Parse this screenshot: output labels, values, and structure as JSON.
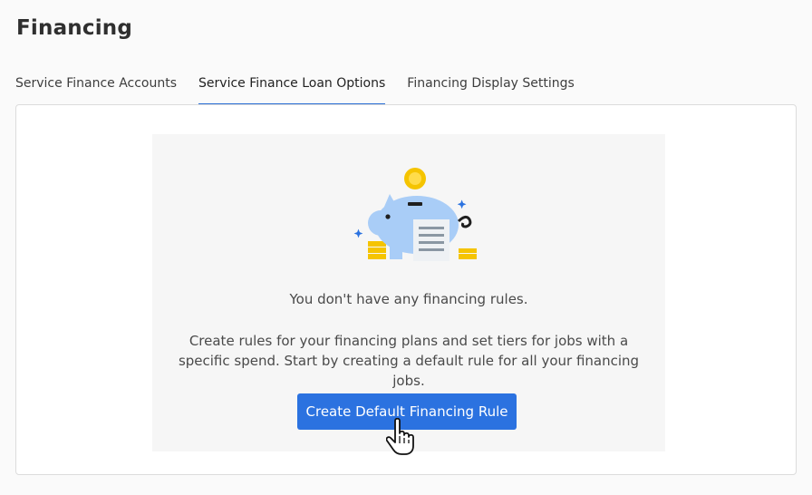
{
  "page": {
    "title": "Financing"
  },
  "tabs": [
    {
      "label": "Service Finance Accounts",
      "active": false
    },
    {
      "label": "Service Finance Loan Options",
      "active": true
    },
    {
      "label": "Financing Display Settings",
      "active": false
    }
  ],
  "empty_state": {
    "illustration": "piggy-bank-icon",
    "title": "You don't have any financing rules.",
    "description": "Create rules for your financing plans and set tiers for jobs with a specific spend. Start by creating a default rule for all your financing jobs.",
    "cta_label": "Create Default Financing Rule"
  },
  "colors": {
    "accent": "#2b72e0",
    "piggy": "#a9cdf7",
    "coin": "#f5c400",
    "sparkle": "#2b72e0"
  },
  "cursor": "hand-pointer-icon"
}
